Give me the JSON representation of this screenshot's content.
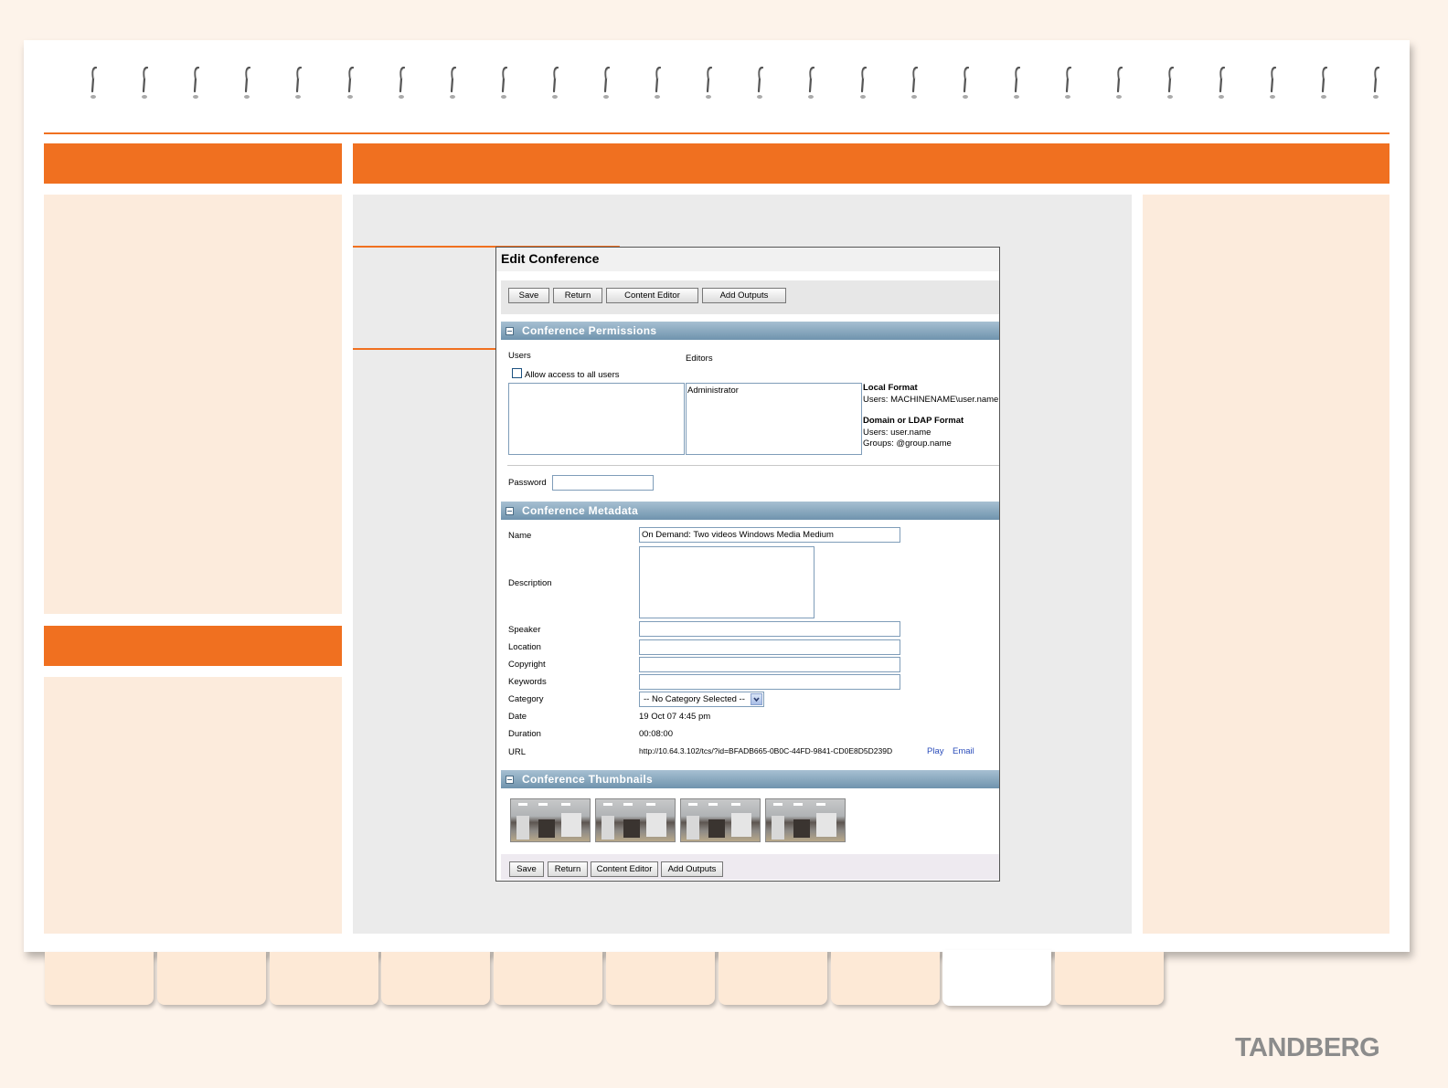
{
  "brand": {
    "logo": "TANDBERG"
  },
  "window": {
    "title": "Edit Conference",
    "toolbar": {
      "save": "Save",
      "return": "Return",
      "content_editor": "Content Editor",
      "add_outputs": "Add Outputs"
    },
    "permissions": {
      "heading": "Conference Permissions",
      "users_label": "Users",
      "editors_label": "Editors",
      "allow_all": "Allow access to all users",
      "editors_value": "Administrator",
      "local_format_title": "Local Format",
      "local_format_users": "Users: MACHINENAME\\user.name",
      "ldap_title": "Domain or LDAP Format",
      "ldap_users": "Users: user.name",
      "ldap_groups": "Groups: @group.name",
      "password_label": "Password"
    },
    "metadata": {
      "heading": "Conference Metadata",
      "name_label": "Name",
      "name_value": "On Demand: Two videos Windows Media Medium",
      "description_label": "Description",
      "speaker_label": "Speaker",
      "location_label": "Location",
      "copyright_label": "Copyright",
      "keywords_label": "Keywords",
      "category_label": "Category",
      "category_value": "-- No Category Selected --",
      "date_label": "Date",
      "date_value": "19 Oct 07 4:45 pm",
      "duration_label": "Duration",
      "duration_value": "00:08:00",
      "url_label": "URL",
      "url_value": "http://10.64.3.102/tcs/?id=BFADB665-0B0C-44FD-9841-CD0E8D5D239D",
      "play": "Play",
      "email": "Email"
    },
    "thumbnails": {
      "heading": "Conference Thumbnails"
    },
    "bottom_toolbar": {
      "save": "Save",
      "return": "Return",
      "content_editor": "Content Editor",
      "add_outputs": "Add Outputs"
    }
  },
  "colors": {
    "accent": "#f07020",
    "panel": "#fcebdc",
    "section_header": "#7d9db4",
    "logo": "#8c8c8c"
  }
}
